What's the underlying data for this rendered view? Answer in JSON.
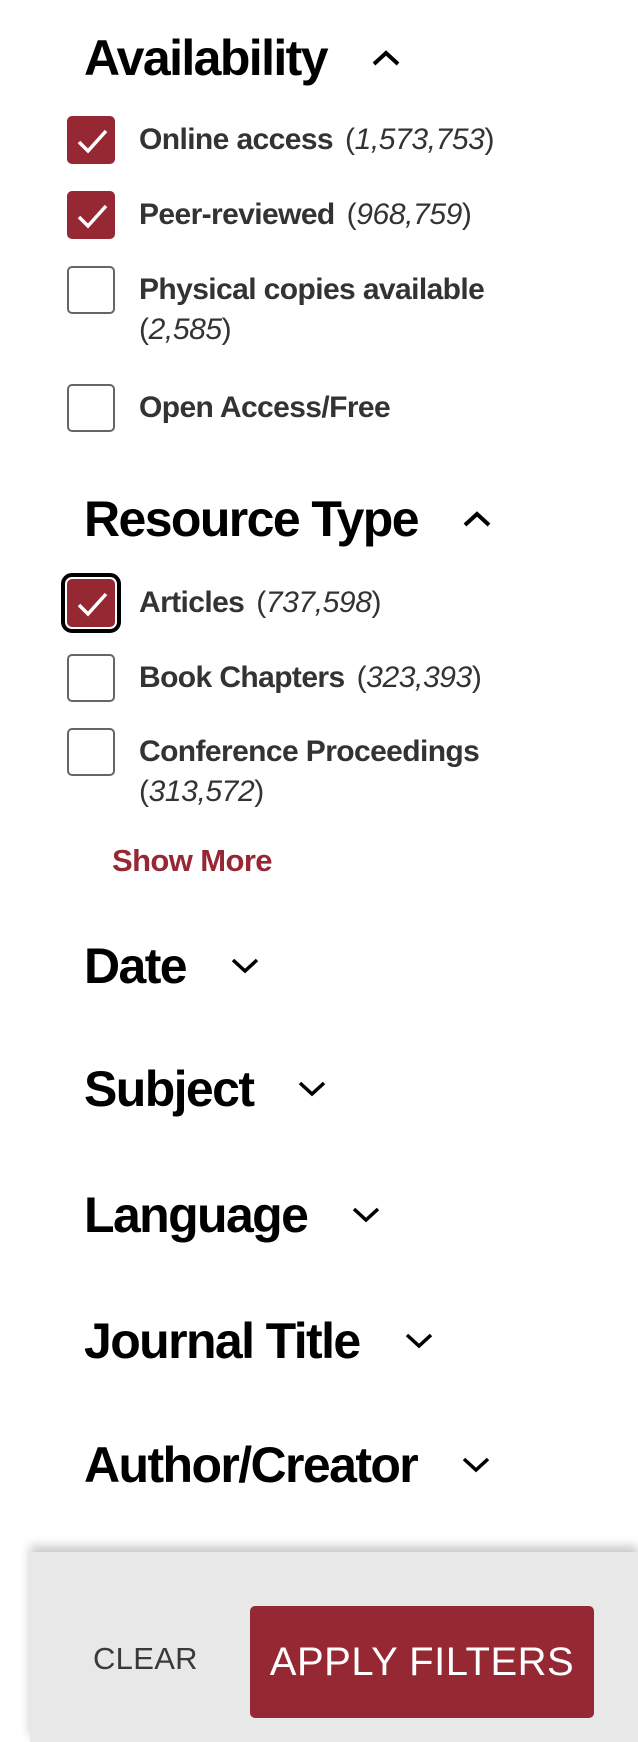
{
  "colors": {
    "accent": "#962834",
    "footer_bg": "#e8e8e8",
    "text": "#333333"
  },
  "facets": {
    "availability": {
      "title": "Availability",
      "state": "expanded",
      "icon": "chevron-up-icon",
      "options": [
        {
          "label": "Online access",
          "count": "1,573,753",
          "checked": true
        },
        {
          "label": "Peer-reviewed",
          "count": "968,759",
          "checked": true
        },
        {
          "label": "Physical copies available",
          "count": "2,585",
          "checked": false
        },
        {
          "label": "Open Access/Free",
          "count": "",
          "checked": false
        }
      ]
    },
    "resource_type": {
      "title": "Resource Type",
      "state": "expanded",
      "icon": "chevron-up-icon",
      "options": [
        {
          "label": "Articles",
          "count": "737,598",
          "checked": true,
          "focused": true
        },
        {
          "label": "Book Chapters",
          "count": "323,393",
          "checked": false
        },
        {
          "label": "Conference Proceedings",
          "count": "313,572",
          "checked": false
        }
      ],
      "show_more": "Show More"
    },
    "collapsed": [
      {
        "title": "Date",
        "icon": "chevron-down-icon"
      },
      {
        "title": "Subject",
        "icon": "chevron-down-icon"
      },
      {
        "title": "Language",
        "icon": "chevron-down-icon"
      },
      {
        "title": "Journal Title",
        "icon": "chevron-down-icon"
      },
      {
        "title": "Author/Creator",
        "icon": "chevron-down-icon"
      }
    ]
  },
  "footer": {
    "clear_label": "CLEAR",
    "apply_label": "APPLY FILTERS"
  }
}
